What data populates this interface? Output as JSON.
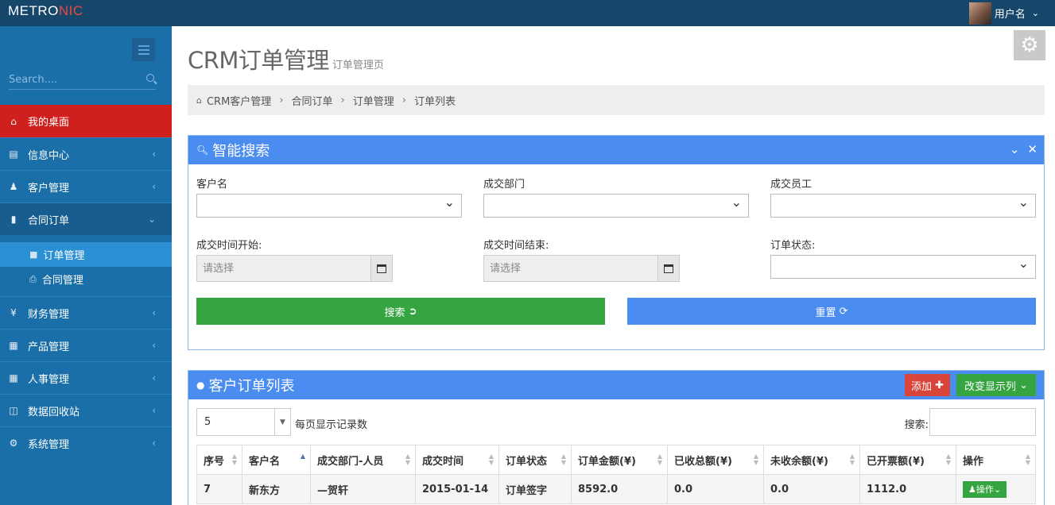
{
  "app": {
    "logo_main": "METRO",
    "logo_accent": "NIC",
    "username": "用户名"
  },
  "sidebar": {
    "search_placeholder": "Search....",
    "items": [
      {
        "label": "我的桌面",
        "icon": "home-icon"
      },
      {
        "label": "信息中心",
        "icon": "envelope-icon"
      },
      {
        "label": "客户管理",
        "icon": "user-icon"
      },
      {
        "label": "合同订单",
        "icon": "book-icon"
      },
      {
        "label": "财务管理",
        "icon": "yen-icon"
      },
      {
        "label": "产品管理",
        "icon": "table-icon"
      },
      {
        "label": "人事管理",
        "icon": "table-icon"
      },
      {
        "label": "数据回收站",
        "icon": "trash-icon"
      },
      {
        "label": "系统管理",
        "icon": "gear-icon"
      }
    ],
    "sub_items": [
      {
        "label": "订单管理",
        "icon": "folder-icon"
      },
      {
        "label": "合同管理",
        "icon": "print-icon"
      }
    ]
  },
  "page": {
    "title": "CRM订单管理",
    "subtitle": "订单管理页",
    "breadcrumb": [
      "CRM客户管理",
      "合同订单",
      "订单管理",
      "订单列表"
    ]
  },
  "search_panel": {
    "title": "智能搜索",
    "labels": {
      "customer": "客户名",
      "department": "成交部门",
      "employee": "成交员工",
      "start": "成交时间开始:",
      "end": "成交时间结束:",
      "status": "订单状态:"
    },
    "date_placeholder": "请选择",
    "search_btn": "搜索",
    "reset_btn": "重置"
  },
  "list_panel": {
    "title": "客户订单列表",
    "add_btn": "添加",
    "cols_btn": "改变显示列",
    "page_size": "5",
    "page_size_label": "每页显示记录数",
    "search_label": "搜索:",
    "columns": [
      "序号",
      "客户名",
      "成交部门-人员",
      "成交时间",
      "订单状态",
      "订单金额(¥)",
      "已收总额(¥)",
      "未收余额(¥)",
      "已开票额(¥)",
      "操作"
    ],
    "rows": [
      [
        "7",
        "新东方",
        "—贺轩",
        "2015-01-14",
        "订单签字",
        "8592.0",
        "0.0",
        "0.0",
        "1112.0",
        "操作"
      ]
    ]
  },
  "colors": {
    "topbar": "#17466b",
    "sidebar": "#1a6fa8",
    "active": "#d0201e",
    "panel_header": "#4a8cf0",
    "green": "#35a541",
    "red": "#d9453b"
  }
}
